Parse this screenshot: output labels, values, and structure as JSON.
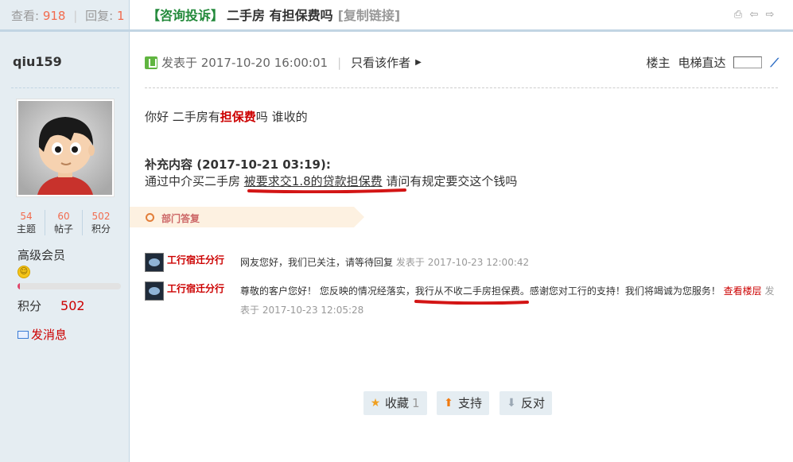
{
  "header": {
    "views_label": "查看:",
    "views": "918",
    "replies_label": "回复:",
    "replies": "1",
    "category": "【咨询投诉】",
    "subject": "二手房 有担保费吗",
    "copy_link": "[复制链接]",
    "tool_icons": [
      "print-icon",
      "prev-thread-icon",
      "next-thread-icon"
    ]
  },
  "author": {
    "name": "qiu159",
    "stats": [
      {
        "value": "54",
        "label": "主题"
      },
      {
        "value": "60",
        "label": "帖子"
      },
      {
        "value": "502",
        "label": "积分"
      }
    ],
    "group": "高级会员",
    "progress_fraction": 0.02,
    "score_label": "积分",
    "score": "502",
    "send_message": "发消息"
  },
  "post": {
    "posted_at": "发表于 2017-10-20 16:00:01",
    "only_author": "只看该作者",
    "floor_label": "楼主",
    "jump_label": "电梯直达",
    "body_prefix": "你好 二手房有",
    "body_highlight": "担保费",
    "body_suffix": "吗 谁收的",
    "supplement_title": "补充内容 (2017-10-21 03:19):",
    "supplement_a": "通过中介买二手房 ",
    "supplement_u": "被要求交1.8的贷款担保费",
    "supplement_b": " 请问有规定要交这个钱吗"
  },
  "department": {
    "label": "部门答复",
    "replies": [
      {
        "name": "工行宿迁分行",
        "text": "网友您好，我们已关注，请等待回复",
        "time_label": "发表于",
        "time": "2017-10-23 12:00:42"
      },
      {
        "name": "工行宿迁分行",
        "text_a": "尊敬的客户您好！ 您反映的情况经落实，",
        "text_b": "我行从不收二手房担保费。",
        "text_c": "感谢您对工行的支持！我们将竭诚为您服务！ ",
        "link": "查看楼层",
        "time_label": " 发表于",
        "time": "2017-10-23 12:05:28"
      }
    ]
  },
  "actions": {
    "favorite": "收藏",
    "favorite_count": "1",
    "support": "支持",
    "oppose": "反对"
  },
  "colors": {
    "accent_red": "#cc0000",
    "side_bg": "#e5edf2",
    "border": "#c2d5e3",
    "category_green": "#22893a"
  }
}
